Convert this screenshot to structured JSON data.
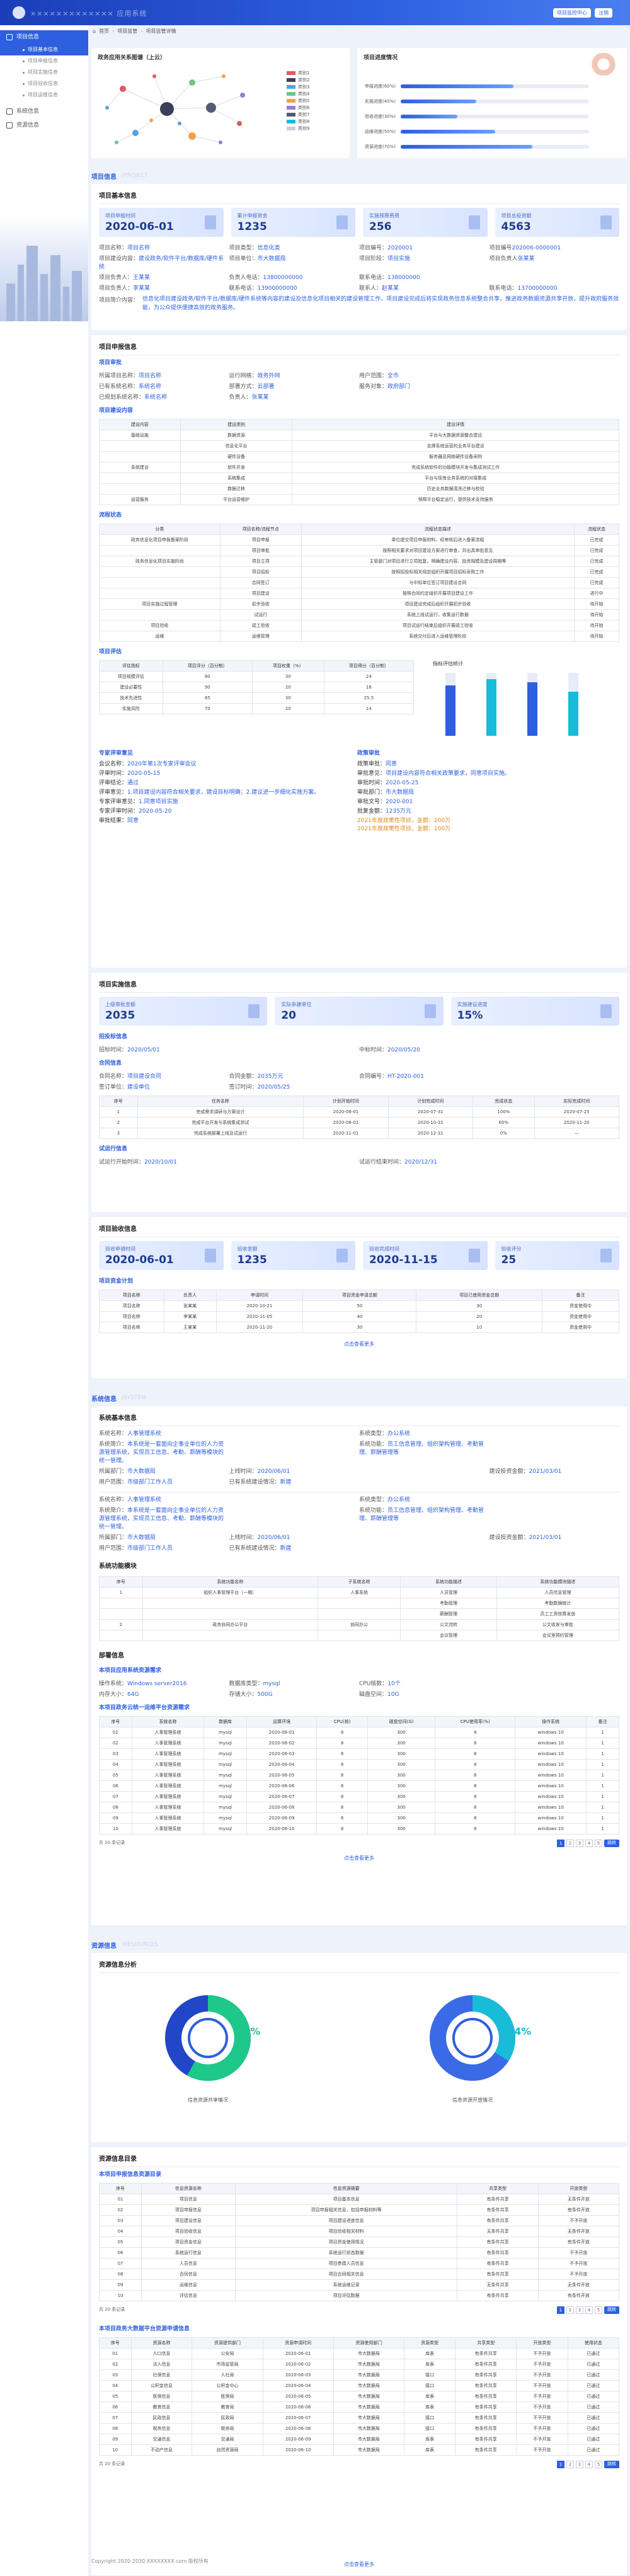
{
  "header": {
    "app_title": "××××××××××××× 应用系统",
    "user_label": "项目监控中心",
    "exit_label": "注销"
  },
  "sidebar": {
    "items": [
      {
        "label": "项目信息",
        "active": true
      },
      {
        "label": "系统信息",
        "active": false
      },
      {
        "label": "资源信息",
        "active": false
      }
    ],
    "subitems": [
      {
        "label": "项目基本信息",
        "active": true
      },
      {
        "label": "项目申报信息",
        "active": false
      },
      {
        "label": "项目实施信息",
        "active": false
      },
      {
        "label": "项目验收信息",
        "active": false
      },
      {
        "label": "项目运维信息",
        "active": false
      }
    ]
  },
  "breadcrumb": {
    "home": "首页",
    "level1": "项目监管",
    "level2": "项目监管详情"
  },
  "top_panels": {
    "graph_title": "政务应用关系图谱（上云）",
    "graph_legend": [
      "类别1",
      "类别2",
      "类别3",
      "类别4",
      "类别5",
      "类别6",
      "类别7",
      "类别8",
      "类别9"
    ],
    "progress_title": "项目进度情况",
    "progress": [
      {
        "label": "申报进度(60%)",
        "value": 60
      },
      {
        "label": "实施进度(40%)",
        "value": 40
      },
      {
        "label": "验收进度(30%)",
        "value": 30
      },
      {
        "label": "运维进度(50%)",
        "value": 50
      },
      {
        "label": "资源进度(70%)",
        "value": 70
      }
    ]
  },
  "sec_project": {
    "title": "项目信息",
    "en": "/PROJECT"
  },
  "basic": {
    "title": "项目基本信息",
    "stats": [
      {
        "label": "项目申报时间",
        "value": "2020-06-01"
      },
      {
        "label": "累计申报资金",
        "value": "1235"
      },
      {
        "label": "实施预算费用",
        "value": "256"
      },
      {
        "label": "项目总投资额",
        "value": "4563"
      }
    ],
    "fields": [
      {
        "k": "项目名称：",
        "v": "项目名称"
      },
      {
        "k": "项目类型：",
        "v": "信息化类"
      },
      {
        "k": "项目编号：",
        "v": "2020001"
      },
      {
        "k": "项目编号",
        "v": "202006-0000001"
      },
      {
        "k": "项目建设内容：",
        "v": "建设政务/软件平台/数据库/硬件系统"
      },
      {
        "k": "项目单位：",
        "v": "市大数据局"
      },
      {
        "k": "项目阶段：",
        "v": "项目实施"
      },
      {
        "k": "项目负责人",
        "v": "张某某"
      },
      {
        "k": "项目负责人：",
        "v": "王某某"
      },
      {
        "k": "负责人电话：",
        "v": "13800000000"
      },
      {
        "k": "联系电话：",
        "v": "138000000"
      },
      {
        "k": "",
        "v": ""
      },
      {
        "k": "项目负责人：",
        "v": "李某某"
      },
      {
        "k": "联系电话：",
        "v": "13900000000"
      },
      {
        "k": "联系人：",
        "v": "赵某某"
      },
      {
        "k": "联系电话：",
        "v": "13700000000"
      }
    ],
    "desc_label": "项目简介内容：",
    "desc": "信息化项目建设政务/软件平台/数据库/硬件系统等内容的建设及信息化项目相关的建设管理工作，项目建设完成后将实现政务信息系统整合共享，推进政务数据资源共享开放，提升政府服务效能，为公众提供便捷高效的政务服务。"
  },
  "apply": {
    "title": "项目申报信息",
    "sub1": "项目审批",
    "fields": [
      {
        "k": "所属项目名称：",
        "v": "项目名称"
      },
      {
        "k": "运行网络：",
        "v": "政务外网"
      },
      {
        "k": "用户范围：",
        "v": "全市"
      },
      {
        "k": "",
        "v": ""
      },
      {
        "k": "已有系统名称：",
        "v": "系统名称"
      },
      {
        "k": "部署方式：",
        "v": "云部署"
      },
      {
        "k": "服务对象：",
        "v": "政府部门"
      },
      {
        "k": "",
        "v": ""
      },
      {
        "k": "已规划系统名称：",
        "v": "系统名称"
      },
      {
        "k": "负责人：",
        "v": "张某某"
      },
      {
        "k": "",
        "v": ""
      },
      {
        "k": "",
        "v": ""
      }
    ],
    "sub2": "项目建设内容",
    "content_headers": [
      "建设内容",
      "建设类别",
      "建设详情"
    ],
    "content_rows": [
      [
        "基础设施",
        "数据资源",
        "平台与大数据资源整合建设"
      ],
      [
        "",
        "信息化平台",
        "支撑系统运营的业务平台建设"
      ],
      [
        "",
        "硬件设备",
        "服务器及网络硬件设备采购"
      ],
      [
        "系统建设",
        "软件开发",
        "完成系统软件的功能模块开发与集成测试工作"
      ],
      [
        "",
        "系统集成",
        "平台与现有业务系统的对接集成"
      ],
      [
        "",
        "数据迁移",
        "历史业务数据清洗迁移与校验"
      ],
      [
        "运营服务",
        "平台运营维护",
        "保障平台稳定运行，提供技术支持服务"
      ]
    ],
    "sub3": "流程状态",
    "flow_headers": [
      "分类",
      "项目名称/流程节点",
      "流程状态描述",
      "流程状态"
    ],
    "flow_rows": [
      [
        "政务信息化项目申报备案阶段",
        "项目申报",
        "单位提交项目申报材料，经审核后进入备案流程",
        "已完成"
      ],
      [
        "",
        "项目审批",
        "按照相关要求对项目建设方案进行审查，并出具审批意见",
        "已完成"
      ],
      [
        "政务信息化项目实施阶段",
        "项目立项",
        "主管部门对项目进行立项批复，明确建设内容、投资规模及建设周期等",
        "已完成"
      ],
      [
        "",
        "项目招标",
        "按照招投标相关规定组织开展项目招标采购工作",
        "已完成"
      ],
      [
        "",
        "合同签订",
        "与中标单位签订项目建设合同",
        "已完成"
      ],
      [
        "",
        "项目建设",
        "按照合同约定组织开展项目建设工作",
        "进行中"
      ],
      [
        "项目实施过程管理",
        "初步验收",
        "项目建设完成后组织开展初步验收",
        "待开始"
      ],
      [
        "",
        "试运行",
        "系统上线试运行，收集运行数据",
        "待开始"
      ],
      [
        "项目验收",
        "竣工验收",
        "项目试运行结束后组织开展竣工验收",
        "待开始"
      ],
      [
        "运维",
        "运维管理",
        "系统交付后进入运维管理阶段",
        "待开始"
      ]
    ],
    "sub4": "项目评估",
    "eval_headers": [
      "评估指标",
      "项目评分（百分制）",
      "项目权重（%）",
      "项目得分（百分制）"
    ],
    "eval_rows": [
      [
        "项目规模评估",
        "80",
        "30",
        "24"
      ],
      [
        "建设必要性",
        "90",
        "20",
        "18"
      ],
      [
        "技术先进性",
        "85",
        "30",
        "25.5"
      ],
      [
        "实施风险",
        "70",
        "20",
        "14"
      ]
    ],
    "eval_chart_title": "指标评估统计",
    "eval_chart": [
      {
        "name": "项目规模",
        "value": 80
      },
      {
        "name": "必要性",
        "value": 90
      },
      {
        "name": "先进性",
        "value": 85
      },
      {
        "name": "风险",
        "value": 70
      }
    ],
    "expert_title": "专家评审意见",
    "expert": [
      {
        "k": "会议名称：",
        "v": "2020年第1次专家评审会议"
      },
      {
        "k": "评审时间：",
        "v": "2020-05-15"
      },
      {
        "k": "评审结论：",
        "v": "通过"
      },
      {
        "k": "评审意见：",
        "v": "1.项目建设内容符合相关要求，建设目标明确；2.建议进一步细化实施方案。"
      },
      {
        "k": "专家评审意见：",
        "v": "1.同意项目实施"
      },
      {
        "k": "专家评审时间：",
        "v": "2020-05-20"
      },
      {
        "k": "审批结果：",
        "v": "同意"
      }
    ],
    "approve_title": "政策审批",
    "approve": [
      {
        "k": "政策审批：",
        "v": "同意"
      },
      {
        "k": "审批意见：",
        "v": "项目建设内容符合相关政策要求，同意项目实施。"
      },
      {
        "k": "审批时间：",
        "v": "2020-05-25"
      },
      {
        "k": "审批部门：",
        "v": "市大数据局"
      },
      {
        "k": "审批文号：",
        "v": "2020-001"
      },
      {
        "k": "批复金额：",
        "v": "1235万元"
      }
    ],
    "approve_warn": [
      "2021年度政策性项目，金额：200万",
      "2021年度政策性项目，金额：100万"
    ]
  },
  "implement": {
    "title": "项目实施信息",
    "stats": [
      {
        "label": "上级审批金额",
        "value": "2035"
      },
      {
        "label": "实际参建单位",
        "value": "20"
      },
      {
        "label": "实施建设进度",
        "value": "15%"
      }
    ],
    "sub1": "招投标信息",
    "fields1": [
      {
        "k": "招标时间：",
        "v": "2020/05/01"
      },
      {
        "k": "",
        "v": ""
      },
      {
        "k": "中标时间：",
        "v": "2020/05/20"
      },
      {
        "k": "",
        "v": ""
      }
    ],
    "sub2": "合同信息",
    "fields2": [
      {
        "k": "合同名称：",
        "v": "项目建设合同"
      },
      {
        "k": "合同金额：",
        "v": "2035万元"
      },
      {
        "k": "合同编号：",
        "v": "HT-2020-001"
      },
      {
        "k": "",
        "v": ""
      },
      {
        "k": "签订单位：",
        "v": "建设单位"
      },
      {
        "k": "签订时间：",
        "v": "2020/05/25"
      },
      {
        "k": "",
        "v": ""
      },
      {
        "k": "",
        "v": ""
      }
    ],
    "plan_headers": [
      "序号",
      "任务名称",
      "计划开始时间",
      "计划完成时间",
      "完成状态",
      "实际完成时间"
    ],
    "plan_rows": [
      [
        "1",
        "完成需求调研与方案设计",
        "2020-06-01",
        "2020-07-31",
        "100%",
        "2020-07-25"
      ],
      [
        "2",
        "完成平台开发与系统集成测试",
        "2020-08-01",
        "2020-10-31",
        "60%",
        "2020-11-20"
      ],
      [
        "3",
        "完成系统部署上线及试运行",
        "2020-11-01",
        "2020-12-31",
        "0%",
        "—"
      ]
    ],
    "sub3": "试运行信息",
    "fields3": [
      {
        "k": "试运行开始时间：",
        "v": "2020/10/01"
      },
      {
        "k": "",
        "v": ""
      },
      {
        "k": "试运行结束时间：",
        "v": "2020/12/31"
      },
      {
        "k": "",
        "v": ""
      }
    ]
  },
  "accept": {
    "title": "项目验收信息",
    "stats": [
      {
        "label": "验收申请时间",
        "value": "2020-06-01"
      },
      {
        "label": "验收金额",
        "value": "1235"
      },
      {
        "label": "验收完成时间",
        "value": "2020-11-15"
      },
      {
        "label": "验收评分",
        "value": "25"
      }
    ],
    "sub1": "项目资金计划",
    "headers": [
      "项目名称",
      "负责人",
      "申请时间",
      "项目资金申请总额",
      "项目已使用资金总额",
      "备注"
    ],
    "rows": [
      [
        "项目名称",
        "张某某",
        "2020-10-21",
        "50",
        "30",
        "资金使用中"
      ],
      [
        "项目名称",
        "李某某",
        "2020-11-05",
        "40",
        "20",
        "资金使用中"
      ],
      [
        "项目名称",
        "王某某",
        "2020-11-20",
        "30",
        "10",
        "资金使用中"
      ]
    ],
    "more": "点击查看更多"
  },
  "sec_system": {
    "title": "系统信息",
    "en": "/SYSTEM"
  },
  "system": {
    "title": "系统基本信息",
    "fields_a": [
      {
        "k": "系统名称：",
        "v": "人事管理系统"
      },
      {
        "k": "",
        "v": ""
      },
      {
        "k": "系统类型：",
        "v": "办公系统"
      },
      {
        "k": "",
        "v": ""
      },
      {
        "k": "系统简介：",
        "v": "本系统是一套面向企事业单位的人力资源管理系统，实现员工信息、考勤、薪酬等模块的统一管理。"
      },
      {
        "k": "",
        "v": ""
      },
      {
        "k": "系统功能：",
        "v": "员工信息管理、组织架构管理、考勤管理、薪酬管理等"
      },
      {
        "k": "",
        "v": ""
      },
      {
        "k": "所属部门：",
        "v": "市大数据局"
      },
      {
        "k": "上线时间：",
        "v": "2020/06/01"
      },
      {
        "k": "",
        "v": ""
      },
      {
        "k": "建设投资金额：",
        "v": "2021/03/01"
      },
      {
        "k": "用户范围：",
        "v": "市级部门工作人员"
      },
      {
        "k": "已有系统建设情况：",
        "v": "新建"
      },
      {
        "k": "",
        "v": ""
      },
      {
        "k": "",
        "v": ""
      }
    ],
    "fields_b": [
      {
        "k": "系统名称：",
        "v": "人事管理系统"
      },
      {
        "k": "",
        "v": ""
      },
      {
        "k": "系统类型：",
        "v": "办公系统"
      },
      {
        "k": "",
        "v": ""
      },
      {
        "k": "系统简介：",
        "v": "本系统是一套面向企事业单位的人力资源管理系统，实现员工信息、考勤、薪酬等模块的统一管理。"
      },
      {
        "k": "",
        "v": ""
      },
      {
        "k": "系统功能：",
        "v": "员工信息管理、组织架构管理、考勤管理、薪酬管理等"
      },
      {
        "k": "",
        "v": ""
      },
      {
        "k": "所属部门：",
        "v": "市大数据局"
      },
      {
        "k": "上线时间：",
        "v": "2020/06/01"
      },
      {
        "k": "",
        "v": ""
      },
      {
        "k": "建设投资金额：",
        "v": "2021/03/01"
      },
      {
        "k": "用户范围：",
        "v": "市级部门工作人员"
      },
      {
        "k": "已有系统建设情况：",
        "v": "新建"
      },
      {
        "k": "",
        "v": ""
      },
      {
        "k": "",
        "v": ""
      }
    ],
    "module_title": "系统功能模块",
    "module_headers": [
      "序号",
      "系统功能名称",
      "子系统名称",
      "系统功能描述",
      "系统功能模块描述"
    ],
    "module_rows": [
      [
        "1",
        "组织人事管理平台（一期）",
        "人事系统",
        "人员管理",
        "人员信息管理"
      ],
      [
        "",
        "",
        "",
        "考勤管理",
        "考勤数据统计"
      ],
      [
        "",
        "",
        "",
        "薪酬管理",
        "员工工资核算发放"
      ],
      [
        "2",
        "政务协同办公平台",
        "协同办公",
        "公文流转",
        "公文收发与审批"
      ],
      [
        "",
        "",
        "",
        "会议管理",
        "会议室预约管理"
      ]
    ],
    "deploy_title": "部署信息",
    "deploy_sub": "本项目应用系统资源需求",
    "deploy_fields": [
      {
        "k": "操作系统：",
        "v": "Windows server2016"
      },
      {
        "k": "数据库类型：",
        "v": "mysql"
      },
      {
        "k": "CPU核数：",
        "v": "10个"
      },
      {
        "k": "",
        "v": ""
      },
      {
        "k": "内存大小：",
        "v": "64G"
      },
      {
        "k": "存储大小：",
        "v": "500G"
      },
      {
        "k": "磁盘空间：",
        "v": "10G"
      },
      {
        "k": "",
        "v": ""
      }
    ],
    "cloud_sub": "本项目政务云统一运维平台资源需求",
    "cloud_headers": [
      "序号",
      "系统名称",
      "数据库",
      "运算环境",
      "CPU(核)",
      "磁盘空间(G)",
      "CPU使用率(%)",
      "操作系统",
      "备注"
    ],
    "cloud_rows": [
      [
        "01",
        "人事管理系统",
        "mysql",
        "2020-06-01",
        "8",
        "300",
        "8",
        "windows 10",
        "1"
      ],
      [
        "02",
        "人事管理系统",
        "mysql",
        "2020-06-02",
        "8",
        "300",
        "8",
        "windows 10",
        "1"
      ],
      [
        "03",
        "人事管理系统",
        "mysql",
        "2020-06-03",
        "8",
        "300",
        "8",
        "windows 10",
        "1"
      ],
      [
        "04",
        "人事管理系统",
        "mysql",
        "2020-06-04",
        "8",
        "300",
        "8",
        "windows 10",
        "1"
      ],
      [
        "05",
        "人事管理系统",
        "mysql",
        "2020-06-05",
        "8",
        "300",
        "8",
        "windows 10",
        "1"
      ],
      [
        "06",
        "人事管理系统",
        "mysql",
        "2020-06-06",
        "8",
        "300",
        "8",
        "windows 10",
        "1"
      ],
      [
        "07",
        "人事管理系统",
        "mysql",
        "2020-06-07",
        "8",
        "300",
        "8",
        "windows 10",
        "1"
      ],
      [
        "08",
        "人事管理系统",
        "mysql",
        "2020-06-08",
        "8",
        "300",
        "8",
        "windows 10",
        "1"
      ],
      [
        "09",
        "人事管理系统",
        "mysql",
        "2020-06-09",
        "8",
        "300",
        "8",
        "windows 10",
        "1"
      ],
      [
        "10",
        "人事管理系统",
        "mysql",
        "2020-06-10",
        "8",
        "300",
        "8",
        "windows 10",
        "1"
      ]
    ],
    "pager_total": "共 20 条记录",
    "pages": [
      "1",
      "2",
      "3",
      "4",
      "5"
    ],
    "go_label": "跳转",
    "more": "点击查看更多"
  },
  "sec_resource": {
    "title": "资源信息",
    "en": "/RESOURCES"
  },
  "resource": {
    "analysis_title": "资源信息分析",
    "donut1": {
      "label": "信息资源共享情况",
      "percent": "58%",
      "value": 58
    },
    "donut2": {
      "label": "信息资源开放情况",
      "percent": "34%",
      "value": 34
    },
    "list_title": "资源信息目录",
    "sub1": "本项目申报信息资源目录",
    "r1_headers": [
      "序号",
      "信息资源名称",
      "信息资源摘要",
      "共享类型",
      "开放类型"
    ],
    "r1_rows": [
      [
        "01",
        "项目信息",
        "项目基本信息",
        "有条件共享",
        "无条件开放"
      ],
      [
        "02",
        "项目申报信息",
        "项目申报相关信息，包括申报材料等",
        "有条件共享",
        "有条件开放"
      ],
      [
        "03",
        "项目建设信息",
        "项目建设进度信息",
        "有条件共享",
        "不予开放"
      ],
      [
        "04",
        "项目验收信息",
        "项目验收相关材料",
        "无条件共享",
        "无条件开放"
      ],
      [
        "05",
        "项目资金信息",
        "项目资金使用情况",
        "有条件共享",
        "有条件开放"
      ],
      [
        "06",
        "系统运行信息",
        "系统运行状态数据",
        "有条件共享",
        "不予开放"
      ],
      [
        "07",
        "人员信息",
        "项目参建人员信息",
        "有条件共享",
        "不予开放"
      ],
      [
        "08",
        "合同信息",
        "项目合同相关信息",
        "有条件共享",
        "不予开放"
      ],
      [
        "09",
        "运维信息",
        "系统运维记录",
        "无条件共享",
        "无条件开放"
      ],
      [
        "10",
        "评估信息",
        "项目评估数据",
        "有条件共享",
        "有条件开放"
      ]
    ],
    "sub2": "本项目政务大数据平台资源申请信息",
    "r2_headers": [
      "序号",
      "资源名称",
      "资源提供部门",
      "资源申请时间",
      "资源使用部门",
      "资源类型",
      "共享类型",
      "开放类型",
      "使用状态"
    ],
    "r2_rows": [
      [
        "01",
        "人口信息",
        "公安局",
        "2020-06-01",
        "市大数据局",
        "库表",
        "有条件共享",
        "不予开放",
        "已通过"
      ],
      [
        "02",
        "法人信息",
        "市场监管局",
        "2020-06-02",
        "市大数据局",
        "库表",
        "有条件共享",
        "不予开放",
        "已通过"
      ],
      [
        "03",
        "社保信息",
        "人社局",
        "2020-06-03",
        "市大数据局",
        "接口",
        "有条件共享",
        "不予开放",
        "已通过"
      ],
      [
        "04",
        "公积金信息",
        "公积金中心",
        "2020-06-04",
        "市大数据局",
        "接口",
        "有条件共享",
        "不予开放",
        "已通过"
      ],
      [
        "05",
        "医保信息",
        "医保局",
        "2020-06-05",
        "市大数据局",
        "库表",
        "有条件共享",
        "不予开放",
        "已通过"
      ],
      [
        "06",
        "教育信息",
        "教育局",
        "2020-06-06",
        "市大数据局",
        "库表",
        "有条件共享",
        "不予开放",
        "已通过"
      ],
      [
        "07",
        "民政信息",
        "民政局",
        "2020-06-07",
        "市大数据局",
        "接口",
        "有条件共享",
        "不予开放",
        "已通过"
      ],
      [
        "08",
        "税务信息",
        "税务局",
        "2020-06-08",
        "市大数据局",
        "接口",
        "有条件共享",
        "不予开放",
        "已通过"
      ],
      [
        "09",
        "交通信息",
        "交通局",
        "2020-06-09",
        "市大数据局",
        "库表",
        "有条件共享",
        "不予开放",
        "已通过"
      ],
      [
        "10",
        "不动产信息",
        "自然资源局",
        "2020-06-10",
        "市大数据局",
        "库表",
        "有条件共享",
        "不予开放",
        "已通过"
      ]
    ],
    "more": "点击查看更多"
  },
  "footer": "Copyright 2020-2030 XXXXXXXX.com 版权所有"
}
